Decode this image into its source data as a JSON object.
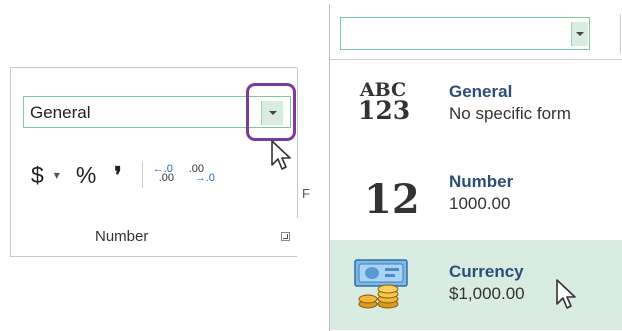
{
  "ribbon": {
    "number_format_value": "General",
    "buttons": {
      "currency_symbol": "$",
      "currency_dropdown": "▾",
      "percent_symbol": "%",
      "comma_symbol": "❜",
      "increase_decimal_top": "←.0",
      "increase_decimal_bottom": ".00",
      "decrease_decimal_top": ".00",
      "decrease_decimal_bottom": "→.0"
    },
    "group_label": "Number",
    "clipped_next_group_letter": "F",
    "highlight_color": "#7a3b9e"
  },
  "dropdown": {
    "combo_value": "",
    "items": [
      {
        "title": "General",
        "description": "No specific form",
        "icon": "abc-123-icon",
        "icon_line1": "ABC",
        "icon_line2": "123"
      },
      {
        "title": "Number",
        "description": "1000.00",
        "icon": "number-12-icon",
        "icon_text": "12"
      },
      {
        "title": "Currency",
        "description": "$1,000.00",
        "icon": "currency-money-icon",
        "selected": true
      }
    ],
    "selected_bg": "#d8ece2",
    "title_color": "#2b4f7a"
  }
}
